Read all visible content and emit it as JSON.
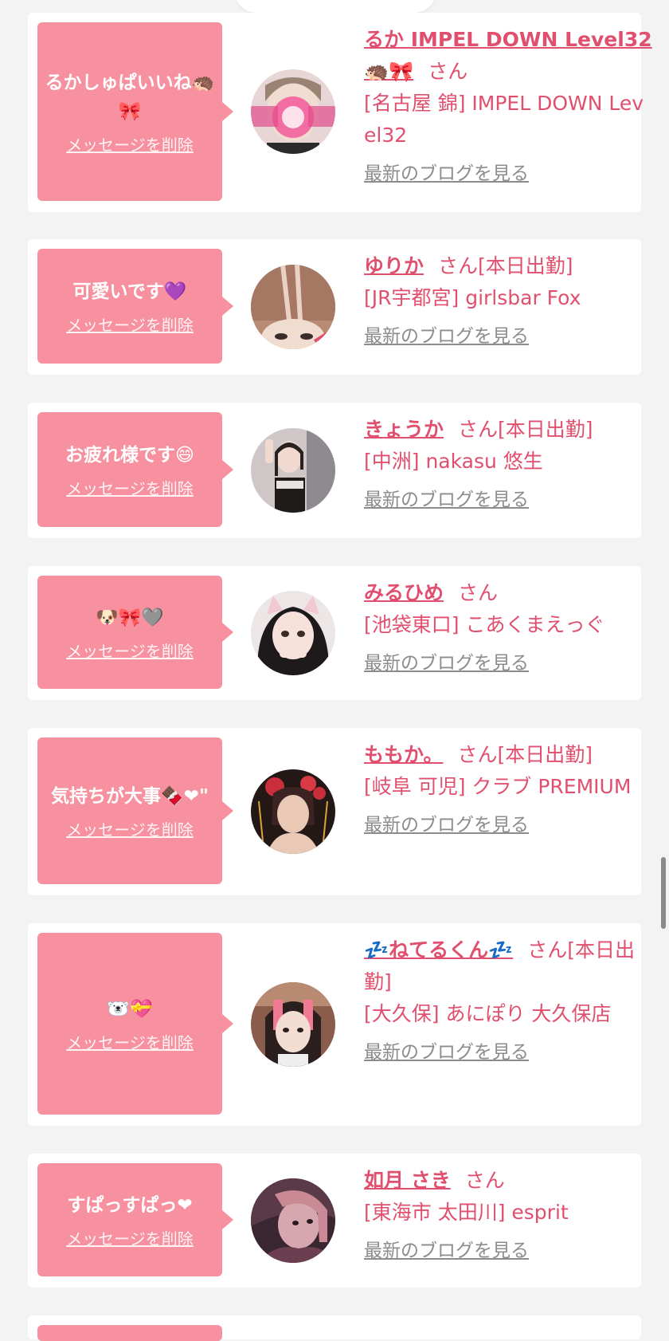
{
  "colors": {
    "accent_pink": "#e0506e",
    "bubble_pink": "#f7909f",
    "link_gray": "#8c8c8c",
    "background": "#f4f3f3",
    "card": "#ffffff"
  },
  "delete_label": "メッセージを削除",
  "blog_label": "最新のブログを見る",
  "honorific": "さん",
  "cards": [
    {
      "message": "るかしゅぱいいね🦔🎀",
      "name": "るか IMPEL DOWN Level32🦔🎀",
      "status": "",
      "shop": "[名古屋 錦] IMPEL DOWN Level32",
      "avatar_icon": "profile-photo-icon"
    },
    {
      "message": "可愛いです💜",
      "name": "ゆりか",
      "status": "[本日出勤]",
      "shop": "[JR宇都宮] girlsbar Fox",
      "avatar_icon": "profile-photo-icon"
    },
    {
      "message": "お疲れ様です😄",
      "name": "きょうか",
      "status": "[本日出勤]",
      "shop": "[中洲] nakasu 悠生",
      "avatar_icon": "profile-photo-icon"
    },
    {
      "message": "🐶🎀🩶",
      "name": "みるひめ",
      "status": "",
      "shop": "[池袋東口] こあくまえっぐ",
      "avatar_icon": "profile-photo-icon"
    },
    {
      "message": "気持ちが大事🍫❤\"",
      "name": "ももか。",
      "status": "[本日出勤]",
      "shop": "[岐阜 可児] クラブ PREMIUM",
      "avatar_icon": "profile-photo-icon"
    },
    {
      "message": "🐻‍❄️💝",
      "name": "💤ねてるくん💤",
      "status": "[本日出勤]",
      "shop": "[大久保] あにぽり 大久保店",
      "avatar_icon": "profile-photo-icon"
    },
    {
      "message": "すぱっすぱっ❤",
      "name": "如月 さき",
      "status": "",
      "shop": "[東海市 太田川] esprit",
      "avatar_icon": "profile-photo-icon"
    }
  ]
}
